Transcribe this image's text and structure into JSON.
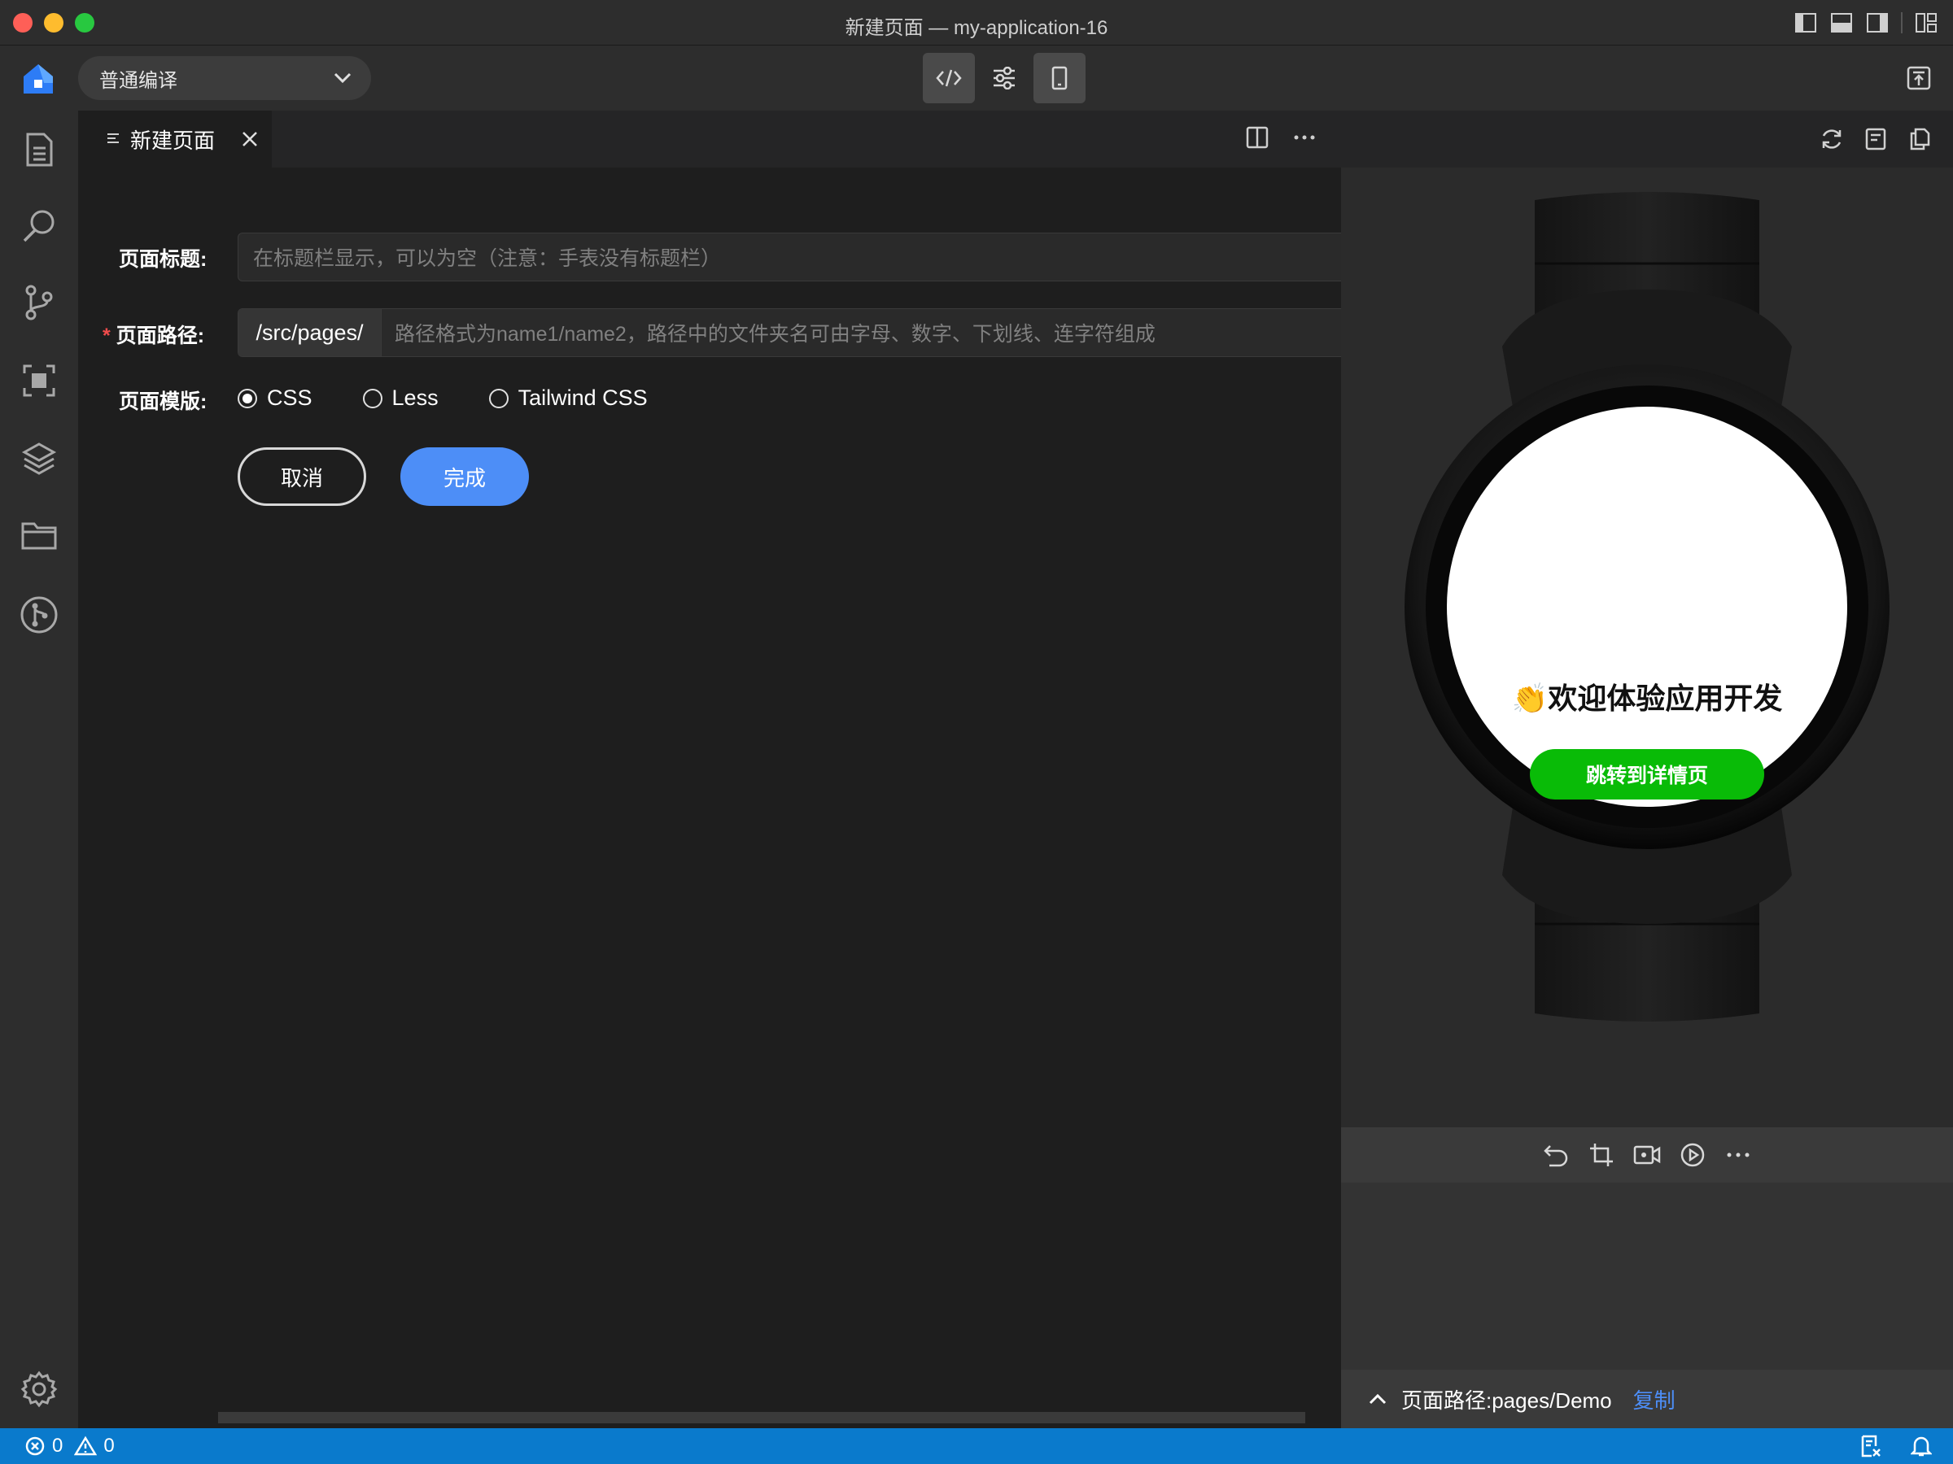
{
  "window": {
    "title": "新建页面 — my-application-16"
  },
  "toolbar": {
    "compile_mode": "普通编译"
  },
  "tab": {
    "label": "新建页面"
  },
  "form": {
    "title_label": "页面标题:",
    "title_placeholder": "在标题栏显示，可以为空（注意：手表没有标题栏）",
    "required_mark": "*",
    "path_label": "页面路径:",
    "path_prefix": "/src/pages/",
    "path_placeholder": "路径格式为name1/name2，路径中的文件夹名可由字母、数字、下划线、连字符组成",
    "template_label": "页面模版:",
    "templates": [
      {
        "label": "CSS",
        "selected": true
      },
      {
        "label": "Less",
        "selected": false
      },
      {
        "label": "Tailwind CSS",
        "selected": false
      }
    ],
    "cancel_label": "取消",
    "done_label": "完成"
  },
  "preview": {
    "watch_text": "👏欢迎体验应用开发",
    "watch_button": "跳转到详情页",
    "footer_path": "页面路径:pages/Demo",
    "footer_copy": "复制"
  },
  "status": {
    "errors": "0",
    "warnings": "0"
  },
  "colors": {
    "accent": "#4d8ef7",
    "statusbar": "#0a7acc",
    "watch_button": "#09bb07",
    "required": "#f14c4c"
  }
}
